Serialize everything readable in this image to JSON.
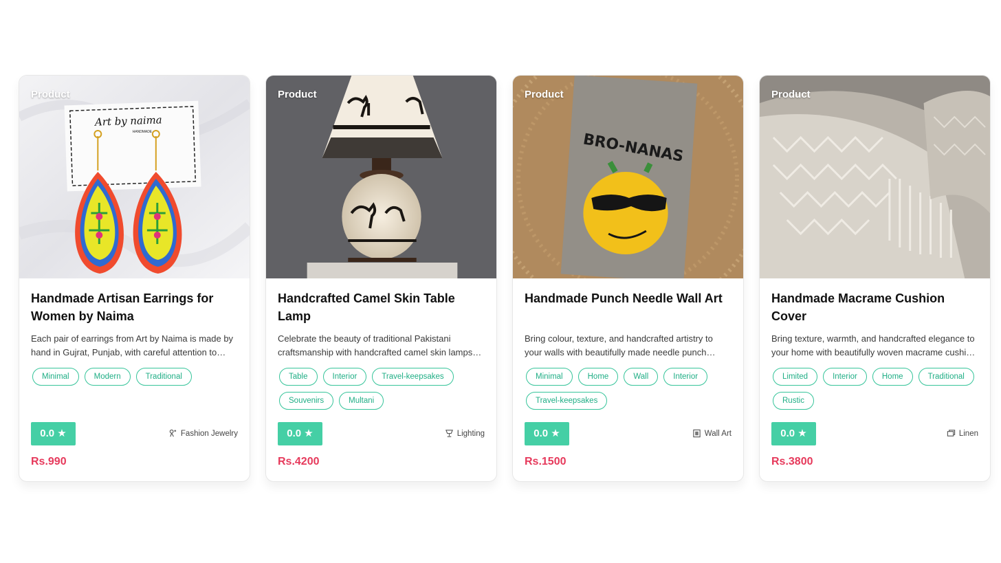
{
  "colors": {
    "accent_green": "#45cfa5",
    "chip_green": "#1fae85",
    "price_red": "#e6395b"
  },
  "products": [
    {
      "badge": "Product",
      "title": "Handmade Artisan Earrings for Women by Naima",
      "description": "Each pair of earrings from Art by Naima is made by hand in Gujrat, Punjab, with careful attention to detail and traditional craft.",
      "tags": [
        "Minimal",
        "Modern",
        "Traditional"
      ],
      "rating": "0.0 ★",
      "category": "Fashion Jewelry",
      "category_icon": "jewelry-icon",
      "price": "Rs.990",
      "image_text": {
        "card_brand": "Art by naima",
        "card_sub": "HANDMADE"
      }
    },
    {
      "badge": "Product",
      "title": "Handcrafted Camel Skin Table Lamp",
      "description": "Celebrate the beauty of traditional Pakistani craftsmanship with handcrafted camel skin lamps made by skilled artisans.",
      "tags": [
        "Table",
        "Interior",
        "Travel-keepsakes",
        "Souvenirs",
        "Multani"
      ],
      "rating": "0.0 ★",
      "category": "Lighting",
      "category_icon": "lamp-icon",
      "price": "Rs.4200"
    },
    {
      "badge": "Product",
      "title": "Handmade Punch Needle Wall Art",
      "description": "Bring colour, texture, and handcrafted artistry to your walls with beautifully made needle punch pieces.",
      "tags": [
        "Minimal",
        "Home",
        "Wall",
        "Interior",
        "Travel-keepsakes"
      ],
      "rating": "0.0 ★",
      "category": "Wall Art",
      "category_icon": "frame-icon",
      "price": "Rs.1500",
      "image_text": {
        "art_caption": "BRO-NANAS"
      }
    },
    {
      "badge": "Product",
      "title": "Handmade Macrame Cushion Cover",
      "description": "Bring texture, warmth, and handcrafted elegance to your home with beautifully woven macrame cushion covers.",
      "tags": [
        "Limited",
        "Interior",
        "Home",
        "Traditional",
        "Rustic"
      ],
      "rating": "0.0 ★",
      "category": "Linen",
      "category_icon": "linen-icon",
      "price": "Rs.3800"
    }
  ]
}
